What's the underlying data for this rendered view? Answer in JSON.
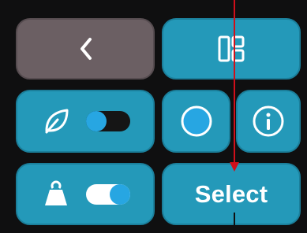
{
  "tiles": {
    "back": {
      "icon": "chevron-left-icon"
    },
    "layout": {
      "icon": "layout-grid-icon"
    },
    "eco": {
      "icon": "leaf-icon",
      "toggle_state": "off"
    },
    "record": {
      "icon": "circle-icon"
    },
    "info": {
      "icon": "info-icon"
    },
    "weight": {
      "icon": "weight-icon",
      "toggle_state": "on"
    },
    "select": {
      "label": "Select"
    }
  },
  "colors": {
    "tile": "#2499b9",
    "tile_border": "#1b7f9b",
    "back_tile": "#6b5f63",
    "background": "#0f0f10",
    "toggle_knob": "#27a6e2",
    "cursor": "#d10f1a"
  }
}
